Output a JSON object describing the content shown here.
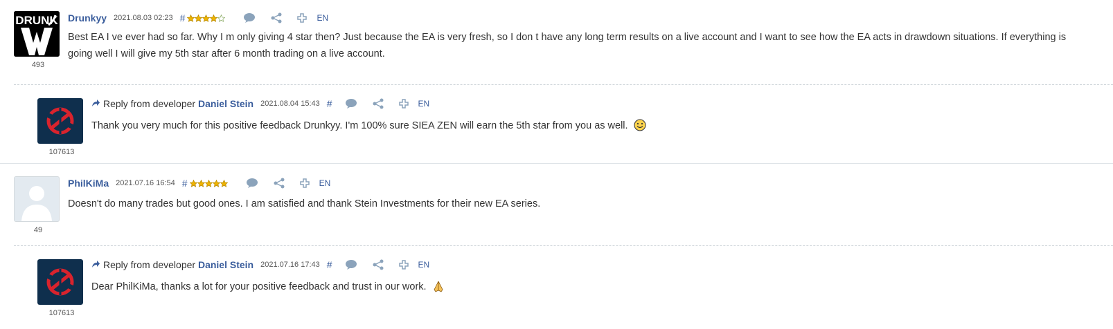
{
  "reviews": [
    {
      "author": "Drunkyy",
      "date": "2021.08.03 02:23",
      "hash": "#",
      "stars": 4,
      "rating_count": "493",
      "lang": "EN",
      "text": "Best EA I ve ever had so far. Why I m only giving 4 star then? Just because the EA is very fresh, so I don t have any long term results on a live account and I want to see how the EA acts in drawdown situations. If everything is going well I will give my 5th star after 6 month trading on a live account.",
      "avatar_text": "DRUNK",
      "reply": {
        "label": "Reply from developer",
        "developer": "Daniel Stein",
        "date": "2021.08.04 15:43",
        "hash": "#",
        "lang": "EN",
        "rating_count": "107613",
        "text": "Thank you very much for this positive feedback Drunkyy. I'm 100% sure SIEA ZEN will earn the 5th star from you as well."
      }
    },
    {
      "author": "PhilKiMa",
      "date": "2021.07.16 16:54",
      "hash": "#",
      "stars": 5,
      "rating_count": "49",
      "lang": "EN",
      "text": "Doesn't do many trades but good ones. I am satisfied and thank Stein Investments for their new EA series.",
      "reply": {
        "label": "Reply from developer",
        "developer": "Daniel Stein",
        "date": "2021.07.16 17:43",
        "hash": "#",
        "lang": "EN",
        "rating_count": "107613",
        "text": "Dear PhilKiMa, thanks a lot for your positive feedback and trust in our work."
      }
    }
  ],
  "colors": {
    "link": "#3a5d9c",
    "star": "#f0b400",
    "icon": "#8ba3bb",
    "dev_logo_bg": "#0f2f4d",
    "dev_logo_fg": "#d9232d"
  }
}
